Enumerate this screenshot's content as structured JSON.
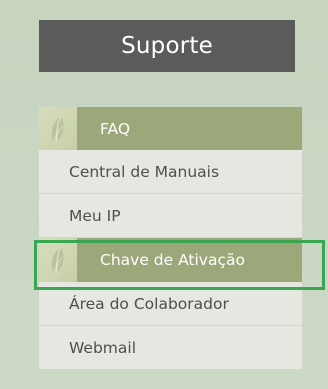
{
  "header": {
    "title": "Suporte"
  },
  "menu": {
    "items": [
      {
        "label": "FAQ",
        "active": true,
        "icon": "leaf-icon"
      },
      {
        "label": "Central de Manuais",
        "active": false
      },
      {
        "label": "Meu IP",
        "active": false
      },
      {
        "label": "Chave de Ativação",
        "active": true,
        "icon": "leaf-icon",
        "highlighted": true
      },
      {
        "label": "Área do Colaborador",
        "active": false
      },
      {
        "label": "Webmail",
        "active": false
      }
    ]
  },
  "colors": {
    "title_bg": "#5b5b5b",
    "active_bg": "#9ca77a",
    "item_bg": "#e6e7e0",
    "highlight_border": "#3aa651"
  }
}
